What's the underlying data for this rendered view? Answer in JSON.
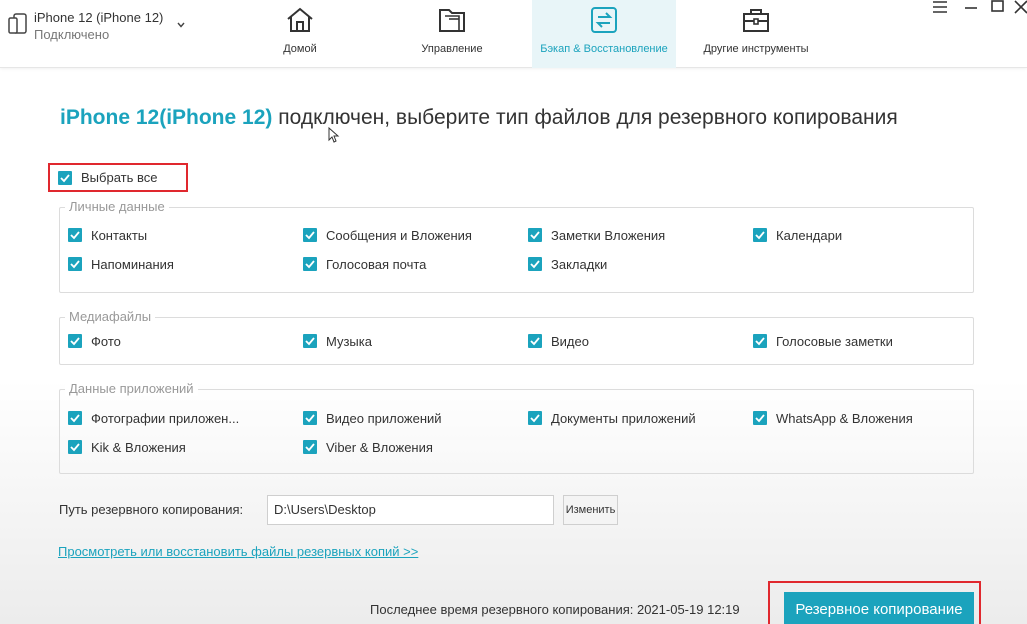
{
  "device": {
    "name": "iPhone 12 (iPhone 12)",
    "status": "Подключено"
  },
  "nav": {
    "home": "Домой",
    "manage": "Управление",
    "backup": "Бэкап & Восстановление",
    "tools": "Другие инструменты"
  },
  "heading": {
    "device": "iPhone 12(iPhone 12)",
    "text": " подключен, выберите тип файлов для резервного копирования"
  },
  "select_all": "Выбрать все",
  "groups": {
    "personal": {
      "title": "Личные данные",
      "items": [
        "Контакты",
        "Сообщения и Вложения",
        "Заметки Вложения",
        "Календари",
        "Напоминания",
        "Голосовая почта",
        "Закладки"
      ]
    },
    "media": {
      "title": "Медиафайлы",
      "items": [
        "Фото",
        "Музыка",
        "Видео",
        "Голосовые заметки"
      ]
    },
    "apps": {
      "title": "Данные приложений",
      "items": [
        "Фотографии приложен...",
        "Видео приложений",
        "Документы приложений",
        "WhatsApp & Вложения",
        "Kik & Вложения",
        "Viber & Вложения"
      ]
    }
  },
  "path": {
    "label": "Путь резервного копирования:",
    "value": "D:\\Users\\Desktop",
    "change": "Изменить"
  },
  "view_link": "Просмотреть или восстановить файлы резервных копий >>",
  "footer": {
    "last_backup": "Последнее время резервного копирования: 2021-05-19 12:19",
    "backup_button": "Резервное копирование"
  },
  "colors": {
    "accent": "#1ba3bd",
    "highlight": "#e0282e"
  }
}
